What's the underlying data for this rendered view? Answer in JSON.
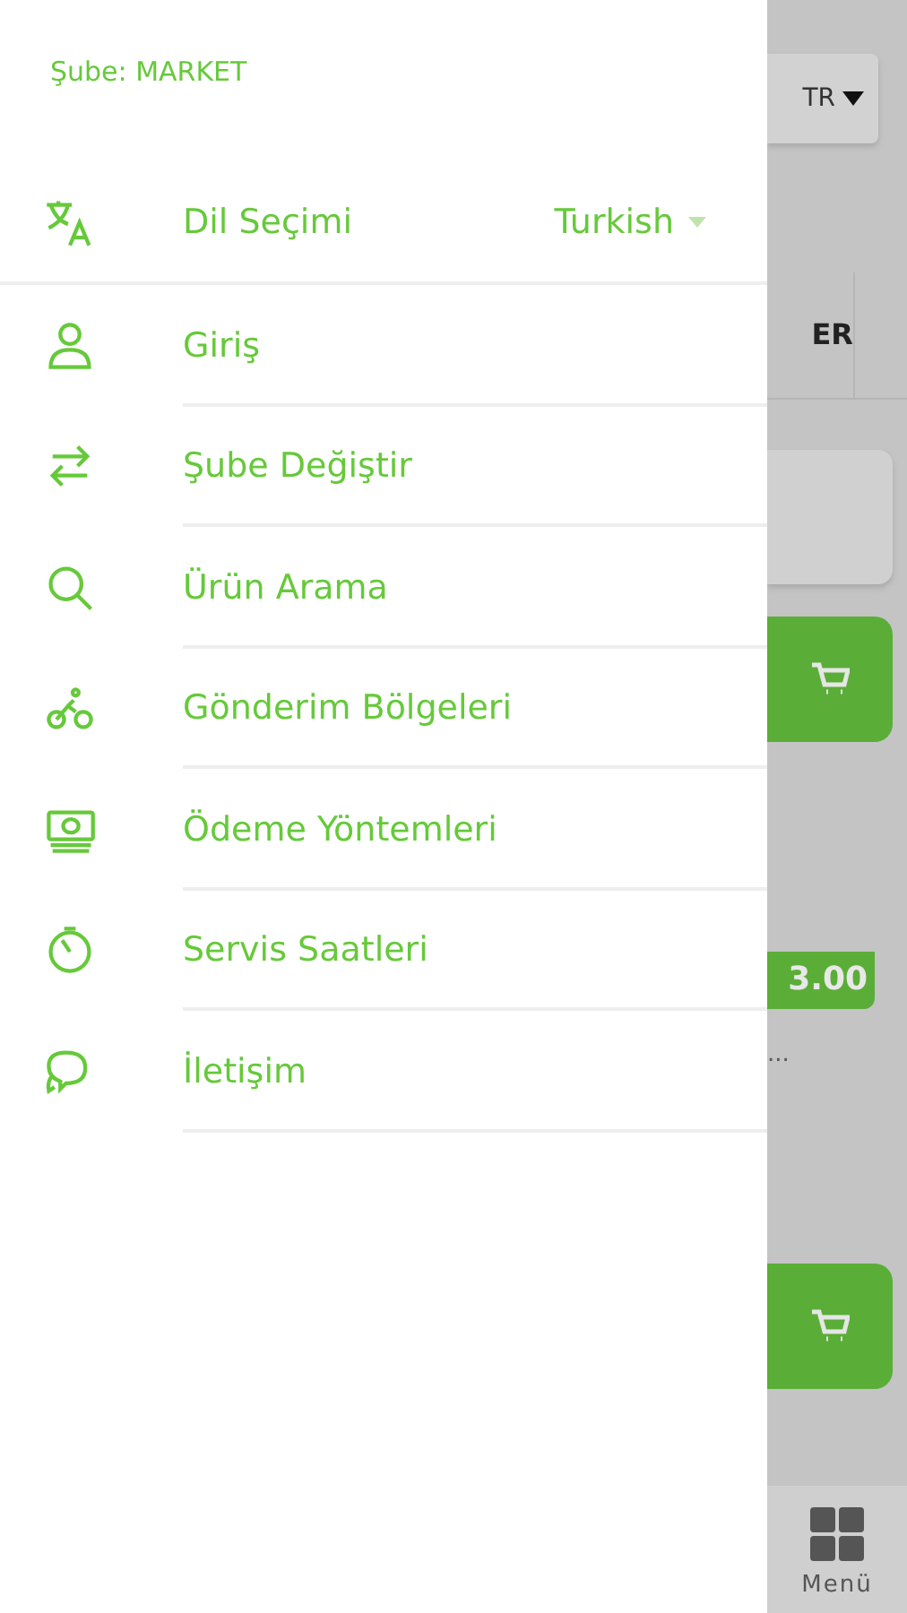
{
  "drawer": {
    "branch_label": "Şube: MARKET",
    "language": {
      "label": "Dil Seçimi",
      "value": "Turkish"
    },
    "items": [
      {
        "kind": "login",
        "label": "Giriş"
      },
      {
        "kind": "branch",
        "label": "Şube Değiştir"
      },
      {
        "kind": "search",
        "label": "Ürün Arama"
      },
      {
        "kind": "delivery",
        "label": "Gönderim Bölgeleri"
      },
      {
        "kind": "payment",
        "label": "Ödeme Yöntemleri"
      },
      {
        "kind": "hours",
        "label": "Servis Saatleri"
      },
      {
        "kind": "contact",
        "label": "İletişim"
      }
    ]
  },
  "background": {
    "language_button": "TR",
    "tab_label": "ER",
    "price": "3.00",
    "product_name": "...",
    "bottom_nav": {
      "label": "Menü"
    }
  }
}
